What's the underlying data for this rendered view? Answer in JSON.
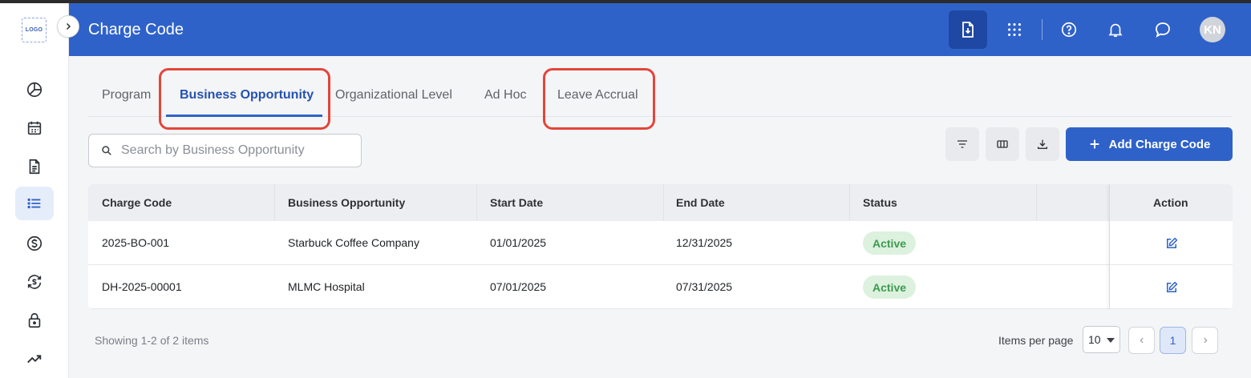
{
  "app": {
    "logo_text": "LOGO",
    "title": "Charge Code",
    "user_initials": "KN"
  },
  "header": {
    "icons": [
      "document-download-icon",
      "apps-grid-icon",
      "help-icon",
      "bell-icon",
      "chat-icon"
    ]
  },
  "sidebar": {
    "items": [
      {
        "name": "dashboard",
        "icon": "pie-chart-icon",
        "active": false
      },
      {
        "name": "calendar",
        "icon": "calendar-icon",
        "active": false
      },
      {
        "name": "documents",
        "icon": "document-icon",
        "active": false
      },
      {
        "name": "charge-codes",
        "icon": "list-icon",
        "active": true
      },
      {
        "name": "billing",
        "icon": "dollar-icon",
        "active": false
      },
      {
        "name": "exchange",
        "icon": "currency-exchange-icon",
        "active": false
      },
      {
        "name": "security",
        "icon": "lock-icon",
        "active": false
      },
      {
        "name": "analytics",
        "icon": "trending-up-icon",
        "active": false
      }
    ]
  },
  "tabs": [
    {
      "label": "Program",
      "active": false
    },
    {
      "label": "Business Opportunity",
      "active": true
    },
    {
      "label": "Organizational Level",
      "active": false
    },
    {
      "label": "Ad Hoc",
      "active": false
    },
    {
      "label": "Leave Accrual",
      "active": false
    }
  ],
  "toolbar": {
    "search_placeholder": "Search by Business Opportunity",
    "add_label": "Add Charge Code"
  },
  "table": {
    "columns": [
      "Charge Code",
      "Business Opportunity",
      "Start Date",
      "End Date",
      "Status",
      "Action"
    ],
    "rows": [
      {
        "charge_code": "2025-BO-001",
        "business_opportunity": "Starbuck Coffee Company",
        "start_date": "01/01/2025",
        "end_date": "12/31/2025",
        "status": "Active"
      },
      {
        "charge_code": "DH-2025-00001",
        "business_opportunity": "MLMC Hospital",
        "start_date": "07/01/2025",
        "end_date": "07/31/2025",
        "status": "Active"
      }
    ]
  },
  "footer": {
    "showing": "Showing 1-2 of 2 items",
    "items_per_page_label": "Items per page",
    "items_per_page": "10",
    "current_page": "1"
  },
  "colors": {
    "header_bg": "#2f62c9",
    "accent": "#2f62c9",
    "highlight_outline": "#e3453a",
    "status_active_bg": "#dcf1de",
    "status_active_text": "#3d9a50"
  }
}
